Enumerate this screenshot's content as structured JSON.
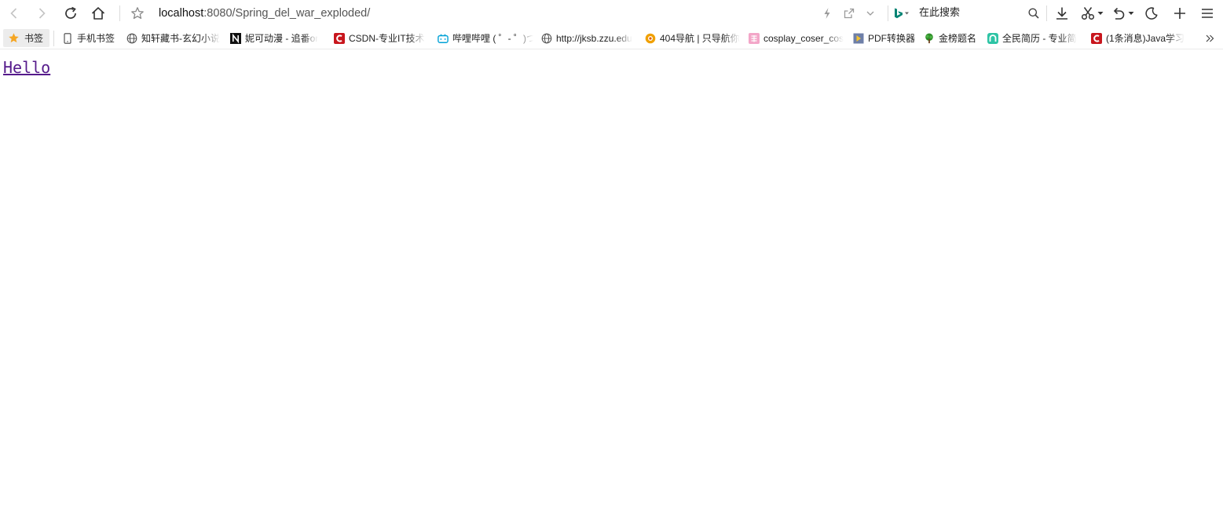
{
  "toolbar": {
    "url_host": "localhost",
    "url_path": ":8080/Spring_del_war_exploded/",
    "search_label": "在此搜索"
  },
  "bookmarks": {
    "main_label": "书签",
    "items": [
      {
        "label": "手机书签",
        "icon": "phone-icon"
      },
      {
        "label": "知轩藏书-玄幻小说",
        "icon": "globe-icon"
      },
      {
        "label": "妮可动漫 - 追番or",
        "icon": "n-logo-icon"
      },
      {
        "label": "CSDN-专业IT技术",
        "icon": "csdn-icon"
      },
      {
        "label": "哔哩哔哩 ( ゜- ゜)つ",
        "icon": "bilibili-icon"
      },
      {
        "label": "http://jksb.zzu.edu",
        "icon": "globe-icon"
      },
      {
        "label": "404导航 | 只导航你",
        "icon": "orange-circle-icon"
      },
      {
        "label": "cosplay_coser_cos",
        "icon": "moe-icon"
      },
      {
        "label": "PDF转换器",
        "icon": "pdf-converter-icon"
      },
      {
        "label": "金榜题名",
        "icon": "tree-icon"
      },
      {
        "label": "全民简历 - 专业简",
        "icon": "resume-icon"
      },
      {
        "label": "(1条消息)Java学习",
        "icon": "csdn-icon"
      }
    ]
  },
  "content": {
    "hello_link": "Hello"
  },
  "colors": {
    "visited_link": "#551a8b",
    "csdn_red": "#c8161d",
    "bilibili_blue": "#00a1d6",
    "bing_teal": "#008373",
    "star_orange": "#f5a623"
  }
}
